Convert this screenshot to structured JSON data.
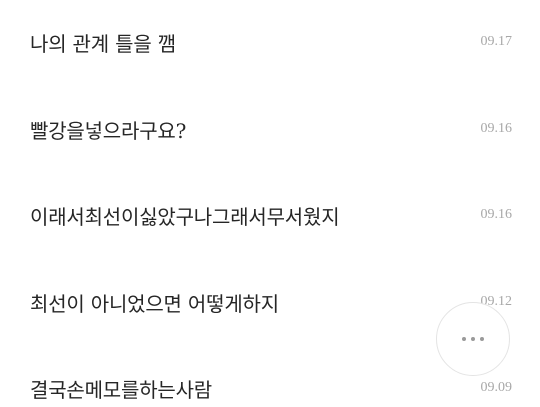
{
  "notes": [
    {
      "title": "나의 관계 틀을 깸",
      "date": "09.17"
    },
    {
      "title": "빨강을넣으라구요?",
      "date": "09.16"
    },
    {
      "title": "이래서최선이싫았구나그래서무서웠지",
      "date": "09.16"
    },
    {
      "title": "최선이 아니었으면 어떻게하지",
      "date": "09.12"
    },
    {
      "title": "결국손메모를하는사람",
      "date": "09.09"
    }
  ],
  "fab": {
    "icon": "more-horizontal-icon"
  }
}
